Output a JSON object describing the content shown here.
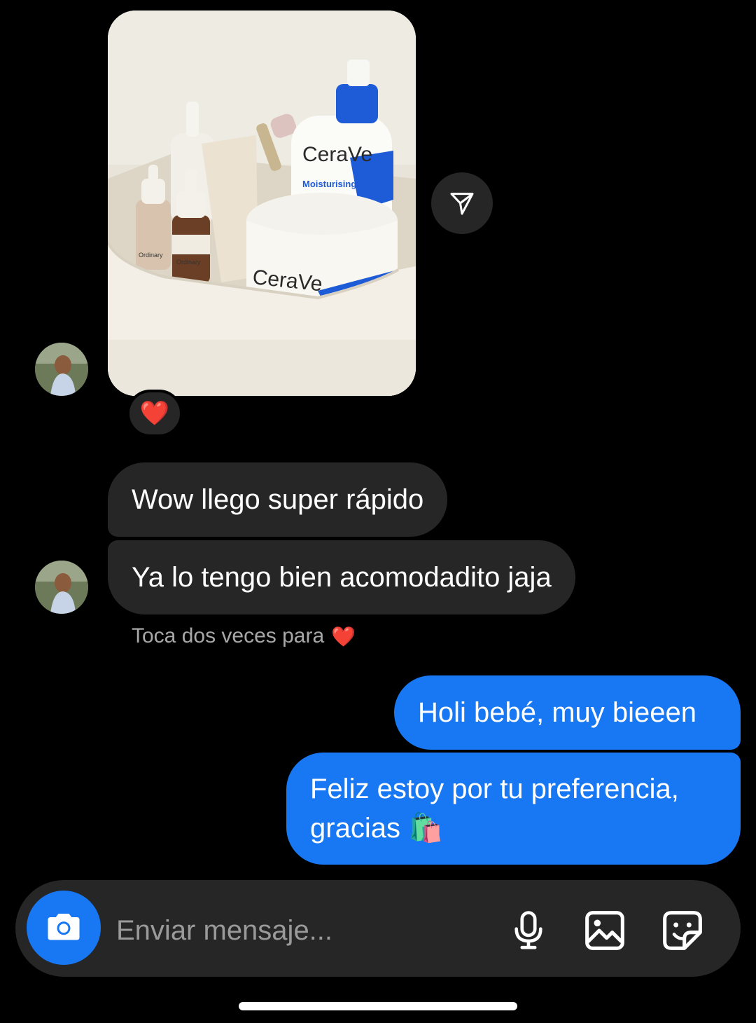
{
  "thread": {
    "photo_message": {
      "image_description_icon": "photo-skincare-products-icon",
      "brand_text_1": "CeraVe",
      "brand_text_2": "Moisturising",
      "brand_text_3": "CeraVe",
      "brand_text_4": "Ordinary",
      "brand_text_5": "Ordinary",
      "reaction": "❤️"
    },
    "messages": [
      {
        "sender": "other",
        "text": "Wow llego super rápido"
      },
      {
        "sender": "other",
        "text": "Ya lo tengo bien acomodadito jaja"
      },
      {
        "sender": "me",
        "text": "Holi bebé, muy bieeen"
      },
      {
        "sender": "me",
        "text": "Feliz estoy por tu preferencia, gracias 🛍️"
      }
    ],
    "hint": {
      "text": "Toca dos veces para",
      "emoji": "❤️"
    }
  },
  "composer": {
    "placeholder": "Enviar mensaje...",
    "icons": [
      "camera-icon",
      "microphone-icon",
      "gallery-icon",
      "sticker-icon"
    ]
  },
  "colors": {
    "background": "#000000",
    "incoming_bubble": "#262626",
    "outgoing_bubble": "#1877f2",
    "accent": "#1877f2",
    "hint_text": "#a8a8a8"
  }
}
